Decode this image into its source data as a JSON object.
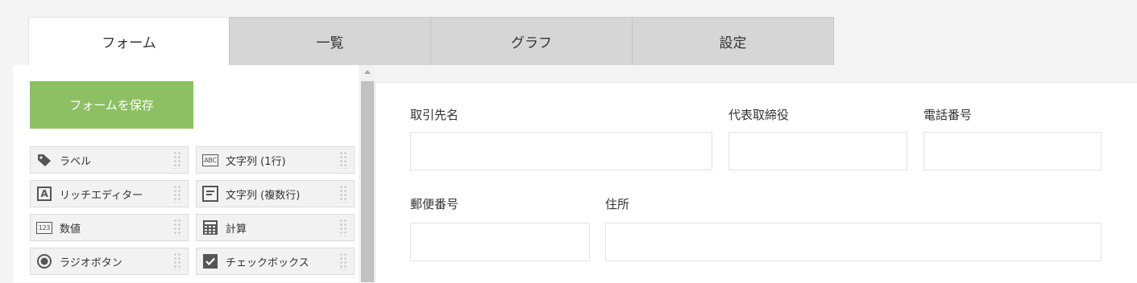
{
  "tabs": [
    {
      "label": "フォーム",
      "active": true
    },
    {
      "label": "一覧",
      "active": false
    },
    {
      "label": "グラフ",
      "active": false
    },
    {
      "label": "設定",
      "active": false
    }
  ],
  "palette": {
    "save_label": "フォームを保存",
    "items": [
      {
        "label": "ラベル",
        "icon": "tag-icon"
      },
      {
        "label": "文字列 (1行)",
        "icon": "abc-text-icon",
        "icon_text": "ABC"
      },
      {
        "label": "リッチエディター",
        "icon": "rich-editor-icon",
        "icon_text": "A"
      },
      {
        "label": "文字列 (複数行)",
        "icon": "multiline-text-icon"
      },
      {
        "label": "数値",
        "icon": "number-icon",
        "icon_text": "123"
      },
      {
        "label": "計算",
        "icon": "calculator-icon"
      },
      {
        "label": "ラジオボタン",
        "icon": "radio-icon"
      },
      {
        "label": "チェックボックス",
        "icon": "checkbox-icon"
      }
    ]
  },
  "form": {
    "fields": [
      {
        "label": "取引先名",
        "value": ""
      },
      {
        "label": "代表取締役",
        "value": ""
      },
      {
        "label": "電話番号",
        "value": ""
      },
      {
        "label": "郵便番号",
        "value": ""
      },
      {
        "label": "住所",
        "value": ""
      }
    ]
  },
  "colors": {
    "save_button": "#8cc063",
    "tab_inactive": "#d6d6d6",
    "tab_active": "#ffffff"
  }
}
